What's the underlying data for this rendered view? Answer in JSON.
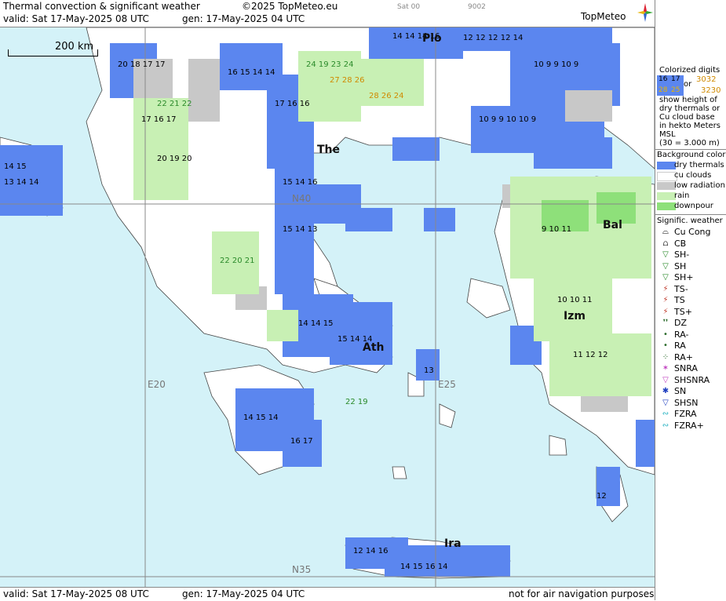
{
  "header": {
    "title": "Thermal convection & significant weather",
    "copyright": "©2025 TopMeteo.eu",
    "valid": "valid:  Sat  17-May-2025  08 UTC",
    "generated": "gen: 17-May-2025 04 UTC",
    "small_left": "Sat 00",
    "small_right": "9002",
    "logo": "TopMeteo"
  },
  "footer": {
    "valid": "valid:  Sat  17-May-2025  08 UTC",
    "generated": "gen: 17-May-2025 04 UTC",
    "disclaimer": "not for air navigation purposes"
  },
  "map": {
    "scale_label": "200 km",
    "cities": [
      {
        "name": "Plo"
      },
      {
        "name": "The"
      },
      {
        "name": "Ath"
      },
      {
        "name": "Bal"
      },
      {
        "name": "Izm"
      },
      {
        "name": "Ira"
      }
    ],
    "grid_labels": {
      "n40": "N40",
      "n35": "N35",
      "e20": "E20",
      "e25": "E25"
    },
    "colors": {
      "sea": "#d4f2f8",
      "dry": "#5b86ef",
      "cu": "#ffffff",
      "low": "#c8c8c8",
      "rain": "#c8f0b4",
      "downpour": "#8ee07a"
    }
  },
  "legend": {
    "colorized_title": "Colorized digits",
    "samples": {
      "a": "16",
      "b": "17",
      "c": "3032",
      "d": "3230",
      "e": "28",
      "f": "25",
      "or": "or"
    },
    "explain": [
      "show height of",
      "dry thermals or",
      "Cu cloud base",
      "in hekto Meters",
      "MSL",
      "(30 = 3.000 m)"
    ],
    "bg_title": "Background color",
    "bg_items": [
      {
        "label": "dry thermals",
        "color": "#5b86ef"
      },
      {
        "label": "cu clouds",
        "color": "#ffffff"
      },
      {
        "label": "low radiation",
        "color": "#c8c8c8"
      },
      {
        "label": "rain",
        "color": "#c8f0b4"
      },
      {
        "label": "downpour",
        "color": "#8ee07a"
      }
    ],
    "sig_title": "Signific. weather",
    "sig_items": [
      {
        "label": "Cu Cong",
        "glyph": "⌓"
      },
      {
        "label": "CB",
        "glyph": "⩍"
      },
      {
        "label": "SH-",
        "glyph": "▽"
      },
      {
        "label": "SH",
        "glyph": "▽"
      },
      {
        "label": "SH+",
        "glyph": "▽"
      },
      {
        "label": "TS-",
        "glyph": "⚡"
      },
      {
        "label": "TS",
        "glyph": "⚡"
      },
      {
        "label": "TS+",
        "glyph": "⚡"
      },
      {
        "label": "DZ",
        "glyph": "❜❜"
      },
      {
        "label": "RA-",
        "glyph": "•"
      },
      {
        "label": "RA",
        "glyph": "•"
      },
      {
        "label": "RA+",
        "glyph": "⁘"
      },
      {
        "label": "SNRA",
        "glyph": "✶"
      },
      {
        "label": "SHSNRA",
        "glyph": "▽"
      },
      {
        "label": "SN",
        "glyph": "✱"
      },
      {
        "label": "SHSN",
        "glyph": "▽"
      },
      {
        "label": "FZRA",
        "glyph": "∾"
      },
      {
        "label": "FZRA+",
        "glyph": "∾"
      }
    ]
  }
}
